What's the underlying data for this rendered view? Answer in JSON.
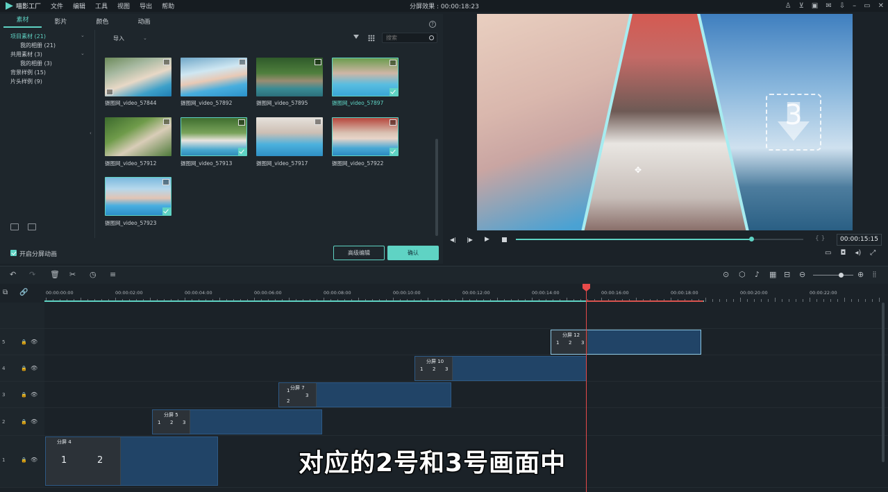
{
  "app": {
    "logo_text": "喵影工厂",
    "menus": [
      "文件",
      "编辑",
      "工具",
      "视图",
      "导出",
      "帮助"
    ],
    "window_title": "分屏效果 : 00:00:18:23"
  },
  "library": {
    "tabs": [
      "素材",
      "影片",
      "颜色",
      "动画"
    ],
    "sidebar": [
      {
        "label": "项目素材 (21)"
      },
      {
        "label": "我的相册 (21)"
      },
      {
        "label": "共用素材 (3)"
      },
      {
        "label": "我的相册 (3)"
      },
      {
        "label": "背景样例 (15)"
      },
      {
        "label": "片头样例 (9)"
      }
    ],
    "import_label": "导入",
    "search_placeholder": "搜索",
    "clips": [
      {
        "name": "摄图网_video_57844"
      },
      {
        "name": "摄图网_video_57892"
      },
      {
        "name": "摄图网_video_57895"
      },
      {
        "name": "摄图网_video_57897"
      },
      {
        "name": "摄图网_video_57912"
      },
      {
        "name": "摄图网_video_57913"
      },
      {
        "name": "摄图网_video_57917"
      },
      {
        "name": "摄图网_video_57922"
      },
      {
        "name": "摄图网_video_57923"
      }
    ],
    "split_anim_label": "开启分屏动画",
    "advanced_label": "高级编辑",
    "ok_label": "确认"
  },
  "preview": {
    "drop_number": "3",
    "timecode": "00:00:15:15",
    "braces": "{  }",
    "progress_fraction": 0.82
  },
  "timeline": {
    "ruler_labels": [
      "00:00:00:00",
      "00:00:02:00",
      "00:00:04:00",
      "00:00:06:00",
      "00:00:08:00",
      "00:00:10:00",
      "00:00:12:00",
      "00:00:14:00",
      "00:00:16:00",
      "00:00:18:00",
      "00:00:20:00",
      "00:00:22:00"
    ],
    "tracks": [
      "5",
      "4",
      "3",
      "2",
      "1"
    ],
    "clips": [
      {
        "title": "分屏 12",
        "nums": [
          "1",
          "2",
          "3"
        ]
      },
      {
        "title": "分屏 10",
        "nums": [
          "1",
          "2",
          "3"
        ]
      },
      {
        "title": "分屏 7",
        "nums": [
          "1",
          "3",
          "2"
        ]
      },
      {
        "title": "分屏 5",
        "nums": [
          "1",
          "2",
          "3"
        ]
      },
      {
        "title": "分屏 4",
        "nums": [
          "1",
          "2"
        ]
      }
    ],
    "subtitle": "对应的2号和3号画面中"
  },
  "colors": {
    "accent": "#5fd3c4",
    "playhead": "#e84a4a",
    "clip": "#214467"
  }
}
